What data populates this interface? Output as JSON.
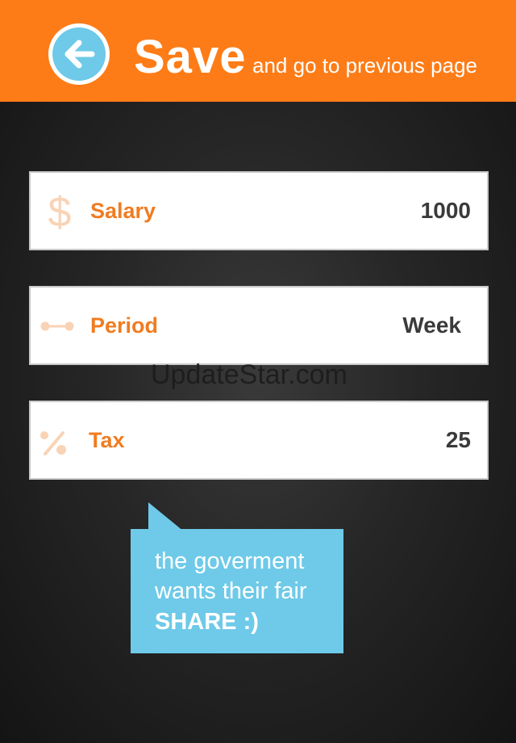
{
  "header": {
    "back_icon": "arrow-left-icon",
    "title": "Save",
    "subtitle": "and go to previous page"
  },
  "fields": [
    {
      "icon": "dollar-icon",
      "label": "Salary",
      "value": "1000"
    },
    {
      "icon": "slider-icon",
      "label": "Period",
      "value": "Week"
    },
    {
      "icon": "percent-icon",
      "label": "Tax",
      "value": "25"
    }
  ],
  "watermark": "UpdateStar.com",
  "bubble": {
    "line1": "the goverment",
    "line2": "wants their fair",
    "line3": "SHARE :)"
  },
  "colors": {
    "accent": "#fd7c17",
    "label": "#f07c21",
    "icon": "#f9d3b5",
    "bubble": "#6ecae8",
    "value": "#3a3a3a"
  }
}
